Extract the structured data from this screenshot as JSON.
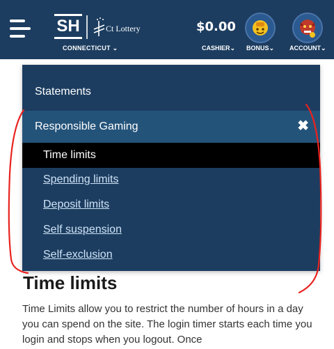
{
  "header": {
    "logo_text": "SH",
    "ct_logo_text": "Ct Lottery",
    "state_selector": "CONNECTICUT ⌄",
    "balance": "$0.00",
    "cashier_label": "CASHIER⌄",
    "bonus_label": "BONUS⌄",
    "account_label": "ACCOUNT⌄"
  },
  "menu": {
    "statements": "Statements",
    "responsible_gaming": "Responsible Gaming",
    "close_symbol": "✖",
    "items": [
      {
        "label": "Time limits",
        "active": true
      },
      {
        "label": "Spending limits",
        "active": false
      },
      {
        "label": "Deposit limits",
        "active": false
      },
      {
        "label": "Self suspension",
        "active": false
      },
      {
        "label": "Self-exclusion",
        "active": false
      }
    ]
  },
  "content": {
    "title": "Time limits",
    "body": "Time Limits allow you to restrict the number of hours in a day you can spend on the site. The login timer starts each time you login and stops when you logout. Once"
  },
  "colors": {
    "header_bg": "#1c3d60",
    "submenu_highlight": "#24537a",
    "active_item": "#000000",
    "annotation": "#e8231f"
  },
  "icons": {
    "menu": "hamburger-icon",
    "bonus": "bonus-icon",
    "account": "account-avatar-icon",
    "close": "close-icon"
  }
}
